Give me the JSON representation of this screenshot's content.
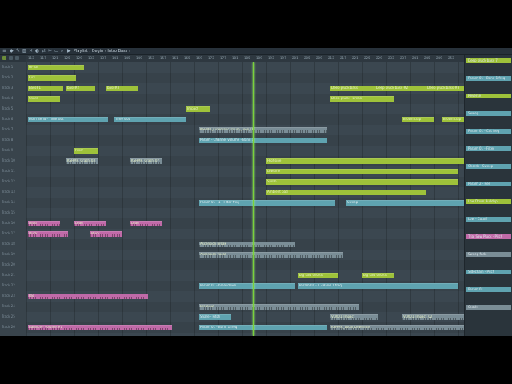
{
  "window": {
    "title": "Playlist › Begin › Intro Bass ›",
    "colors": {
      "window_bg": "#323d45",
      "playhead": "#7bd23a",
      "pattern": "#9ec23a",
      "automation": "#5fa3b0",
      "audio": "#7a8d96",
      "pink": "#c06aa8"
    }
  },
  "toolbar_icons": [
    "menu-icon",
    "snap-icon",
    "draw-icon",
    "paint-icon",
    "delete-icon",
    "mute-icon",
    "slip-icon",
    "slice-icon",
    "select-icon",
    "zoom-icon",
    "playback-icon",
    "magnet-icon"
  ],
  "ruler": {
    "bars": [
      "113",
      "117",
      "121",
      "125",
      "129",
      "133",
      "137",
      "141",
      "145",
      "149",
      "153",
      "157",
      "161",
      "165",
      "169",
      "173",
      "177",
      "181",
      "185",
      "189",
      "193",
      "197",
      "201",
      "205",
      "209",
      "213",
      "217",
      "221",
      "225",
      "229",
      "233",
      "237",
      "241",
      "245",
      "249",
      "253"
    ]
  },
  "tracks": [
    "Track 1",
    "Track 2",
    "Track 3",
    "Track 4",
    "Track 5",
    "Track 6",
    "Track 7",
    "Track 8",
    "Track 9",
    "Track 10",
    "Track 11",
    "Track 12",
    "Track 13",
    "Track 14",
    "Track 15",
    "Track 16",
    "Track 17",
    "Track 18",
    "Track 19",
    "Track 20",
    "Track 21",
    "Track 22",
    "Track 23",
    "Track 24",
    "Track 25",
    "Track 26"
  ],
  "clips": [
    {
      "label": "Hi-hat",
      "track": 0,
      "type": "pattern"
    },
    {
      "label": "Kick",
      "track": 1,
      "type": "pattern"
    },
    {
      "label": "bass#1",
      "track": 2,
      "type": "pattern"
    },
    {
      "label": "bass#2",
      "track": 2,
      "type": "pattern"
    },
    {
      "label": "bass#3",
      "track": 2,
      "type": "pattern"
    },
    {
      "label": "Deep pluck bass",
      "track": 2,
      "type": "pattern"
    },
    {
      "label": "Deep pluck bass #2",
      "track": 2,
      "type": "pattern"
    },
    {
      "label": "Deep pluck bass #3",
      "track": 2,
      "type": "pattern"
    },
    {
      "label": "Snare",
      "track": 3,
      "type": "pattern"
    },
    {
      "label": "Deep pluck - Break",
      "track": 3,
      "type": "pattern"
    },
    {
      "label": "Impact",
      "track": 4,
      "type": "pattern"
    },
    {
      "label": "Pitch Bend - Time slot",
      "track": 5,
      "type": "automation"
    },
    {
      "label": "Time slot",
      "track": 5,
      "type": "automation"
    },
    {
      "label": "Brown clap",
      "track": 5,
      "type": "pattern"
    },
    {
      "label": "Brown clap",
      "track": 5,
      "type": "pattern"
    },
    {
      "label": "KSHMR_Cinematic_Drum_Loop_01",
      "track": 6,
      "type": "audio"
    },
    {
      "label": "Param - Channel volume - Band 1",
      "track": 7,
      "type": "automation"
    },
    {
      "label": "Riser",
      "track": 8,
      "type": "pattern"
    },
    {
      "label": "KSHMR_Crash_03",
      "track": 9,
      "type": "audio"
    },
    {
      "label": "KSHMR_Crash_07",
      "track": 9,
      "type": "audio"
    },
    {
      "label": "Highsine",
      "track": 9,
      "type": "pattern"
    },
    {
      "label": "Lowsine",
      "track": 10,
      "type": "pattern"
    },
    {
      "label": "Synth",
      "track": 11,
      "type": "pattern"
    },
    {
      "label": "Ambient pad",
      "track": 12,
      "type": "pattern"
    },
    {
      "label": "Param 01 - 1 - Filter freq",
      "track": 13,
      "type": "automation"
    },
    {
      "label": "Sweep",
      "track": 13,
      "type": "automation"
    },
    {
      "label": "Lead",
      "track": 15,
      "type": "pink"
    },
    {
      "label": "Lead",
      "track": 15,
      "type": "pink"
    },
    {
      "label": "Lead",
      "track": 15,
      "type": "pink"
    },
    {
      "label": "Pluck",
      "track": 16,
      "type": "pink"
    },
    {
      "label": "Pluck",
      "track": 16,
      "type": "pink"
    },
    {
      "label": "Ascension break",
      "track": 17,
      "type": "audio"
    },
    {
      "label": "Ascension vocal",
      "track": 18,
      "type": "audio"
    },
    {
      "label": "big saw chords",
      "track": 20,
      "type": "pattern"
    },
    {
      "label": "big saw chords",
      "track": 20,
      "type": "pattern"
    },
    {
      "label": "Param 01 - breakdown",
      "track": 21,
      "type": "automation"
    },
    {
      "label": "Param 01 - 1 - Band 1 freq",
      "track": 21,
      "type": "automation"
    },
    {
      "label": "Pad",
      "track": 22,
      "type": "pink"
    },
    {
      "label": "Breakout",
      "track": 23,
      "type": "audio"
    },
    {
      "label": "Snare - Pitch",
      "track": 24,
      "type": "automation"
    },
    {
      "label": "Param 01 - Band 1 freq",
      "track": 25,
      "type": "automation"
    },
    {
      "label": "Balance - Volume #1",
      "track": 25,
      "type": "pink"
    },
    {
      "label": "VOX01_Impact",
      "track": 24,
      "type": "audio"
    },
    {
      "label": "VOX01_Impact_02",
      "track": 24,
      "type": "audio"
    },
    {
      "label": "KSHMR_Vocal_Downlifter",
      "track": 25,
      "type": "audio"
    }
  ],
  "right_panel": {
    "items": [
      {
        "label": "Deep pluck bass 7",
        "type": "pattern"
      },
      {
        "label": "Param 01 - Band 1 freq",
        "type": "automation"
      },
      {
        "label": "Reverse",
        "type": "pattern"
      },
      {
        "label": "Sweep",
        "type": "automation"
      },
      {
        "label": "Param 01 - Cut freq",
        "type": "automation"
      },
      {
        "label": "Param 01 - Filter",
        "type": "automation"
      },
      {
        "label": "Chords - Sweep",
        "type": "automation"
      },
      {
        "label": "Param 2 - Res",
        "type": "automation"
      },
      {
        "label": "Low Drum Buildup",
        "type": "pattern"
      },
      {
        "label": "Low - Cutoff",
        "type": "automation"
      },
      {
        "label": "Trial Saw Pluck - Pitch",
        "type": "pink"
      },
      {
        "label": "Sweep fade",
        "type": "audio"
      },
      {
        "label": "Sidechain - Pitch",
        "type": "automation"
      },
      {
        "label": "Param 01",
        "type": "automation"
      },
      {
        "label": "Crash",
        "type": "audio"
      }
    ]
  }
}
